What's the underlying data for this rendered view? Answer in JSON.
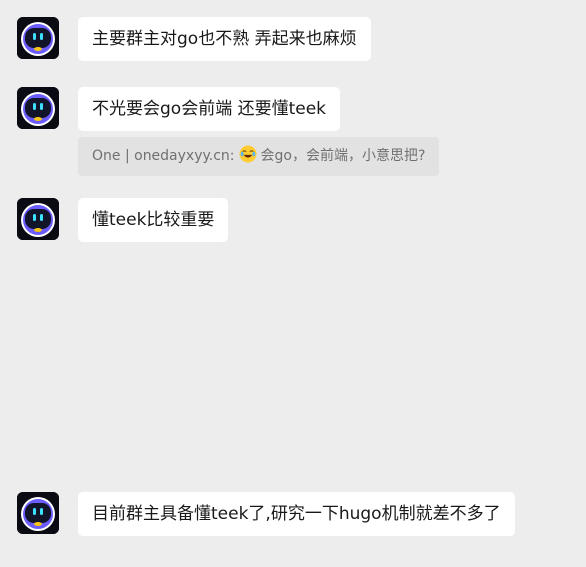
{
  "messages": [
    {
      "text": "主要群主对go也不熟 弄起来也麻烦"
    },
    {
      "text": "不光要会go会前端 还要懂teek",
      "quote": {
        "prefix": "One | onedayxyy.cn:",
        "emoji": "joy-emoji",
        "text": "会go，会前端，小意思把?"
      }
    },
    {
      "text": "懂teek比较重要"
    },
    {
      "text": "目前群主具备懂teek了,研究一下hugo机制就差不多了"
    }
  ],
  "colors": {
    "background": "#ededed",
    "bubble": "#ffffff",
    "quote_bg": "#e2e2e2",
    "avatar_accent": "#6a5cff"
  }
}
